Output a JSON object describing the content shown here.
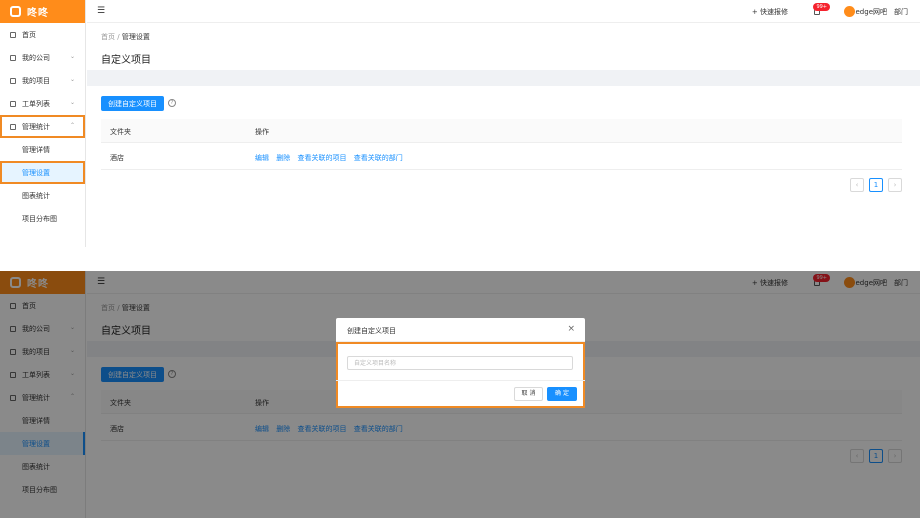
{
  "app": {
    "logo_text": "咚咚"
  },
  "sidebar": {
    "items": [
      {
        "label": "首页"
      },
      {
        "label": "我的公司"
      },
      {
        "label": "我的项目"
      },
      {
        "label": "工单列表"
      },
      {
        "label": "管理统计"
      }
    ],
    "sub_items": [
      {
        "label": "管理详情"
      },
      {
        "label": "管理设置"
      },
      {
        "label": "图表统计"
      },
      {
        "label": "项目分布图"
      }
    ]
  },
  "topbar": {
    "quick_repair": "+ 快速报修",
    "badge": "99+",
    "user_name": "edge网吧",
    "dept": "部门"
  },
  "page": {
    "breadcrumb_home": "首页",
    "breadcrumb_sep": "/",
    "breadcrumb_current": "管理设置",
    "title": "自定义项目"
  },
  "table": {
    "create_button": "创建自定义项目",
    "help_icon": "?",
    "headers": [
      "文件夹",
      "操作"
    ],
    "rows": [
      {
        "name": "酒店",
        "actions": [
          "编辑",
          "删除",
          "查看关联的项目",
          "查看关联的部门"
        ]
      }
    ]
  },
  "pagination": {
    "prev": "‹",
    "current": "1",
    "next": "›"
  },
  "modal": {
    "title": "创建自定义项目",
    "close": "×",
    "input_placeholder": "自定义项目名称",
    "cancel": "取 消",
    "ok": "确 定"
  }
}
